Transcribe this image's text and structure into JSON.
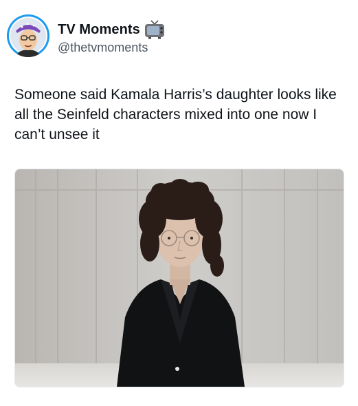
{
  "author": {
    "display_name": "TV Moments",
    "handle": "@thetvmoments",
    "avatar_icon": "cartoon-character-avatar",
    "badge_icon": "tv-icon"
  },
  "tweet": {
    "text": "Someone said Kamala Harris’s daughter looks like all the Seinfeld characters mixed into one now I can’t unsee it"
  },
  "media": {
    "type": "photo",
    "icon": "portrait-photo"
  },
  "colors": {
    "text": "#0f1419",
    "secondary_text": "#4a5560",
    "avatar_bg": "#1d9bf0"
  }
}
